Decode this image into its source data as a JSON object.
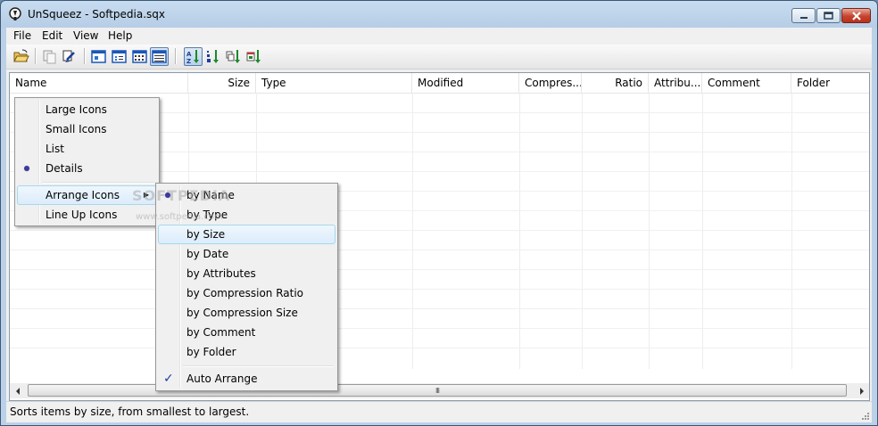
{
  "window": {
    "title": "UnSqueez - Softpedia.sqx",
    "icon": "app-icon"
  },
  "menubar": {
    "items": [
      "File",
      "Edit",
      "View",
      "Help"
    ]
  },
  "toolbar": {
    "buttons": [
      {
        "icon": "open-folder-icon"
      },
      {
        "icon": "extract-files-icon"
      },
      {
        "icon": "extract-to-icon"
      },
      {
        "icon": "large-icons-view-icon"
      },
      {
        "icon": "small-icons-view-icon"
      },
      {
        "icon": "list-view-icon"
      },
      {
        "icon": "details-view-icon",
        "pressed": true
      },
      {
        "icon": "sort-by-name-icon",
        "pressed": true
      },
      {
        "icon": "sort-by-type-icon"
      },
      {
        "icon": "sort-by-size-icon"
      },
      {
        "icon": "sort-by-date-icon"
      }
    ]
  },
  "listview": {
    "columns": [
      "Name",
      "Size",
      "Type",
      "Modified",
      "Compres...",
      "Ratio",
      "Attribu...",
      "Comment",
      "Folder"
    ]
  },
  "context_menu": {
    "items": [
      {
        "label": "Large Icons"
      },
      {
        "label": "Small Icons"
      },
      {
        "label": "List"
      },
      {
        "label": "Details",
        "selected": true
      },
      {
        "label": "Arrange Icons",
        "submenu": true,
        "highlighted": true
      },
      {
        "label": "Line Up Icons"
      }
    ]
  },
  "submenu": {
    "items": [
      {
        "label": "by Name",
        "selected": true
      },
      {
        "label": "by Type"
      },
      {
        "label": "by Size",
        "highlighted": true
      },
      {
        "label": "by Date"
      },
      {
        "label": "by Attributes"
      },
      {
        "label": "by Compression Ratio"
      },
      {
        "label": "by Compression Size"
      },
      {
        "label": "by Comment"
      },
      {
        "label": "by Folder"
      },
      {
        "label": "Auto Arrange",
        "checked": true
      }
    ]
  },
  "scrollbar": {
    "thumb_grip": "III"
  },
  "status": {
    "text": "Sorts items by size, from smallest to largest."
  },
  "watermark": {
    "text": "SOFTPEDIA",
    "url": "www.softpedia.com"
  }
}
